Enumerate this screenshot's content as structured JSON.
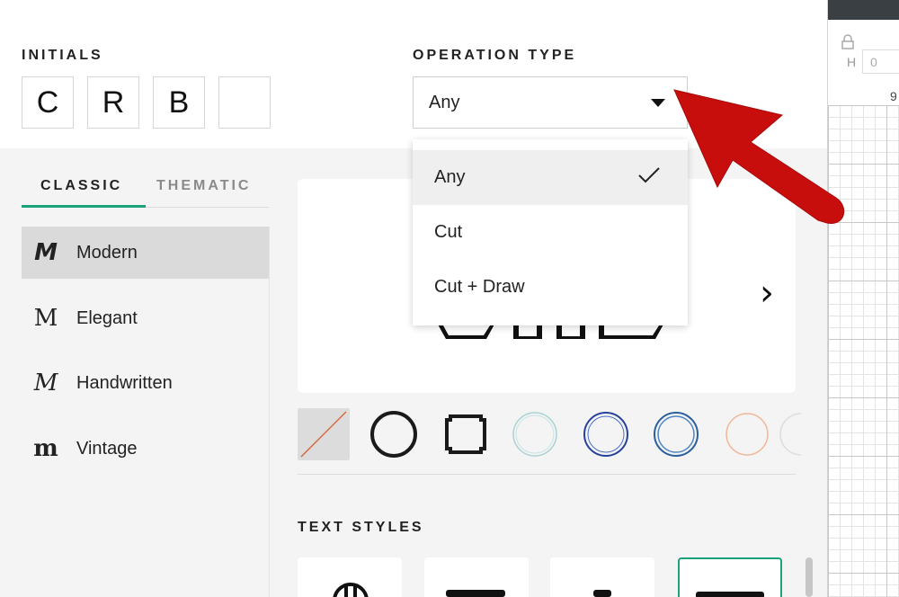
{
  "initials": {
    "label": "INITIALS",
    "boxes": [
      "C",
      "R",
      "B",
      ""
    ]
  },
  "operation_type": {
    "label": "OPERATION TYPE",
    "selected": "Any",
    "options": [
      "Any",
      "Cut",
      "Cut + Draw"
    ]
  },
  "tabs": [
    {
      "label": "CLASSIC",
      "active": true
    },
    {
      "label": "THEMATIC",
      "active": false
    }
  ],
  "fonts": [
    {
      "icon_glyph": "M",
      "label": "Modern",
      "selected": true
    },
    {
      "icon_glyph": "M",
      "label": "Elegant",
      "selected": false
    },
    {
      "icon_glyph": "M",
      "label": "Handwritten",
      "selected": false
    },
    {
      "icon_glyph": "m",
      "label": "Vintage",
      "selected": false
    }
  ],
  "text_styles": {
    "label": "TEXT STYLES"
  },
  "canvas": {
    "height_label": "H",
    "height_value": "0",
    "ruler_mark": "9"
  },
  "colors": {
    "accent": "#1aa37a",
    "arrow": "#c80d0d",
    "selected_bg": "#dadada",
    "panel_bg": "#f4f4f4"
  },
  "icons": {
    "dropdown": "caret-down-icon",
    "check": "checkmark-icon",
    "next": "chevron-right-icon",
    "lock": "lock-icon",
    "annotation": "red-arrow-icon"
  }
}
